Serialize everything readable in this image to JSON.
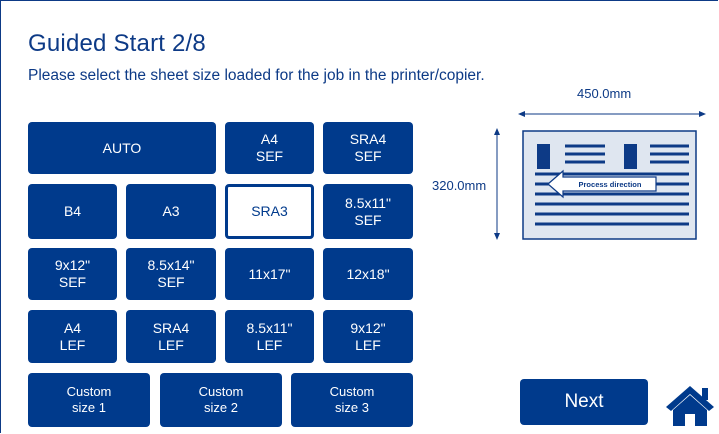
{
  "header": {
    "title": "Guided Start 2/8",
    "subtitle": "Please select the sheet size loaded for the job in the printer/copier."
  },
  "sizes": [
    {
      "label": "AUTO"
    },
    {
      "label": "A4\nSEF"
    },
    {
      "label": "SRA4\nSEF"
    },
    {
      "label": "B4"
    },
    {
      "label": "A3"
    },
    {
      "label": "SRA3",
      "selected": true
    },
    {
      "label": "8.5x11\"\nSEF"
    },
    {
      "label": "9x12\"\nSEF"
    },
    {
      "label": "8.5x14\"\nSEF"
    },
    {
      "label": "11x17\""
    },
    {
      "label": "12x18\""
    },
    {
      "label": "A4\nLEF"
    },
    {
      "label": "SRA4\nLEF"
    },
    {
      "label": "8.5x11\"\nLEF"
    },
    {
      "label": "9x12\"\nLEF"
    },
    {
      "label": "Custom\nsize 1"
    },
    {
      "label": "Custom\nsize 2"
    },
    {
      "label": "Custom\nsize 3"
    }
  ],
  "diagram": {
    "width_label": "450.0mm",
    "height_label": "320.0mm",
    "direction_label": "Process direction"
  },
  "footer": {
    "next_label": "Next"
  },
  "colors": {
    "primary": "#003a8c",
    "paper": "#dfe6f0"
  }
}
